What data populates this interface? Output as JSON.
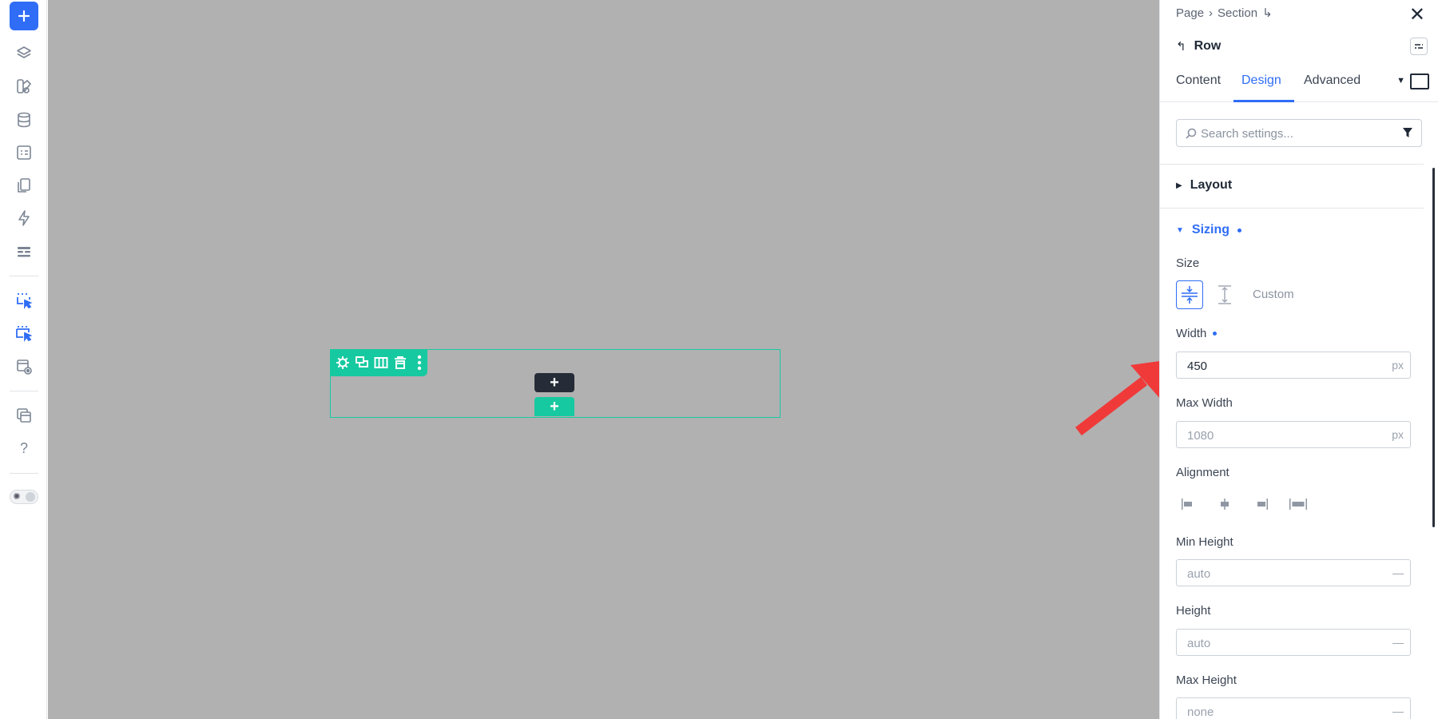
{
  "toolbar": {
    "items": [
      {
        "icon": "plus-icon"
      },
      {
        "icon": "layers-icon"
      },
      {
        "icon": "palette-icon"
      },
      {
        "icon": "database-icon"
      },
      {
        "icon": "form-icon"
      },
      {
        "icon": "pages-icon"
      },
      {
        "icon": "lightning-icon"
      },
      {
        "icon": "list-icon"
      },
      {
        "icon": "select-element-icon"
      },
      {
        "icon": "select-multiple-icon"
      },
      {
        "icon": "preview-icon"
      },
      {
        "icon": "templates-icon"
      },
      {
        "icon": "help-icon"
      }
    ],
    "help_label": "?",
    "theme_toggle": {
      "icon": "sun-icon"
    }
  },
  "canvas": {
    "background": "#b1b1b1",
    "row_toolbar": {
      "color": "#17c9a0",
      "icons": [
        "gear-icon",
        "duplicate-icon",
        "columns-icon",
        "trash-icon",
        "more-vertical-icon"
      ]
    },
    "add_dark_label": "+",
    "add_green_label": "+"
  },
  "panel": {
    "breadcrumb": {
      "items": [
        "Page",
        "Section"
      ],
      "separator": "›",
      "return_symbol": "↳"
    },
    "close_label": "✕",
    "element_title": "Row",
    "back_symbol": "↰",
    "tabs": [
      {
        "label": "Content",
        "active": false
      },
      {
        "label": "Design",
        "active": true
      },
      {
        "label": "Advanced",
        "active": false
      }
    ],
    "dropdown_symbol": "▼",
    "search": {
      "placeholder": "Search settings..."
    },
    "sections": {
      "layout": {
        "label": "Layout",
        "expanded": false,
        "toggle": "▶"
      },
      "sizing": {
        "label": "Sizing",
        "expanded": true,
        "toggle": "▼",
        "modified": true
      }
    },
    "size": {
      "label": "Size",
      "custom_label": "Custom"
    },
    "width": {
      "label": "Width",
      "value": "450",
      "unit": "px"
    },
    "max_width": {
      "label": "Max Width",
      "placeholder": "1080",
      "unit": "px"
    },
    "alignment": {
      "label": "Alignment"
    },
    "min_height": {
      "label": "Min Height",
      "placeholder": "auto",
      "unit": "—"
    },
    "height": {
      "label": "Height",
      "placeholder": "auto",
      "unit": "—"
    },
    "max_height": {
      "label": "Max Height",
      "placeholder": "none",
      "unit": "—"
    },
    "accent_color": "#2f6df6"
  },
  "annotation": {
    "arrow_color": "#f03a3a"
  }
}
